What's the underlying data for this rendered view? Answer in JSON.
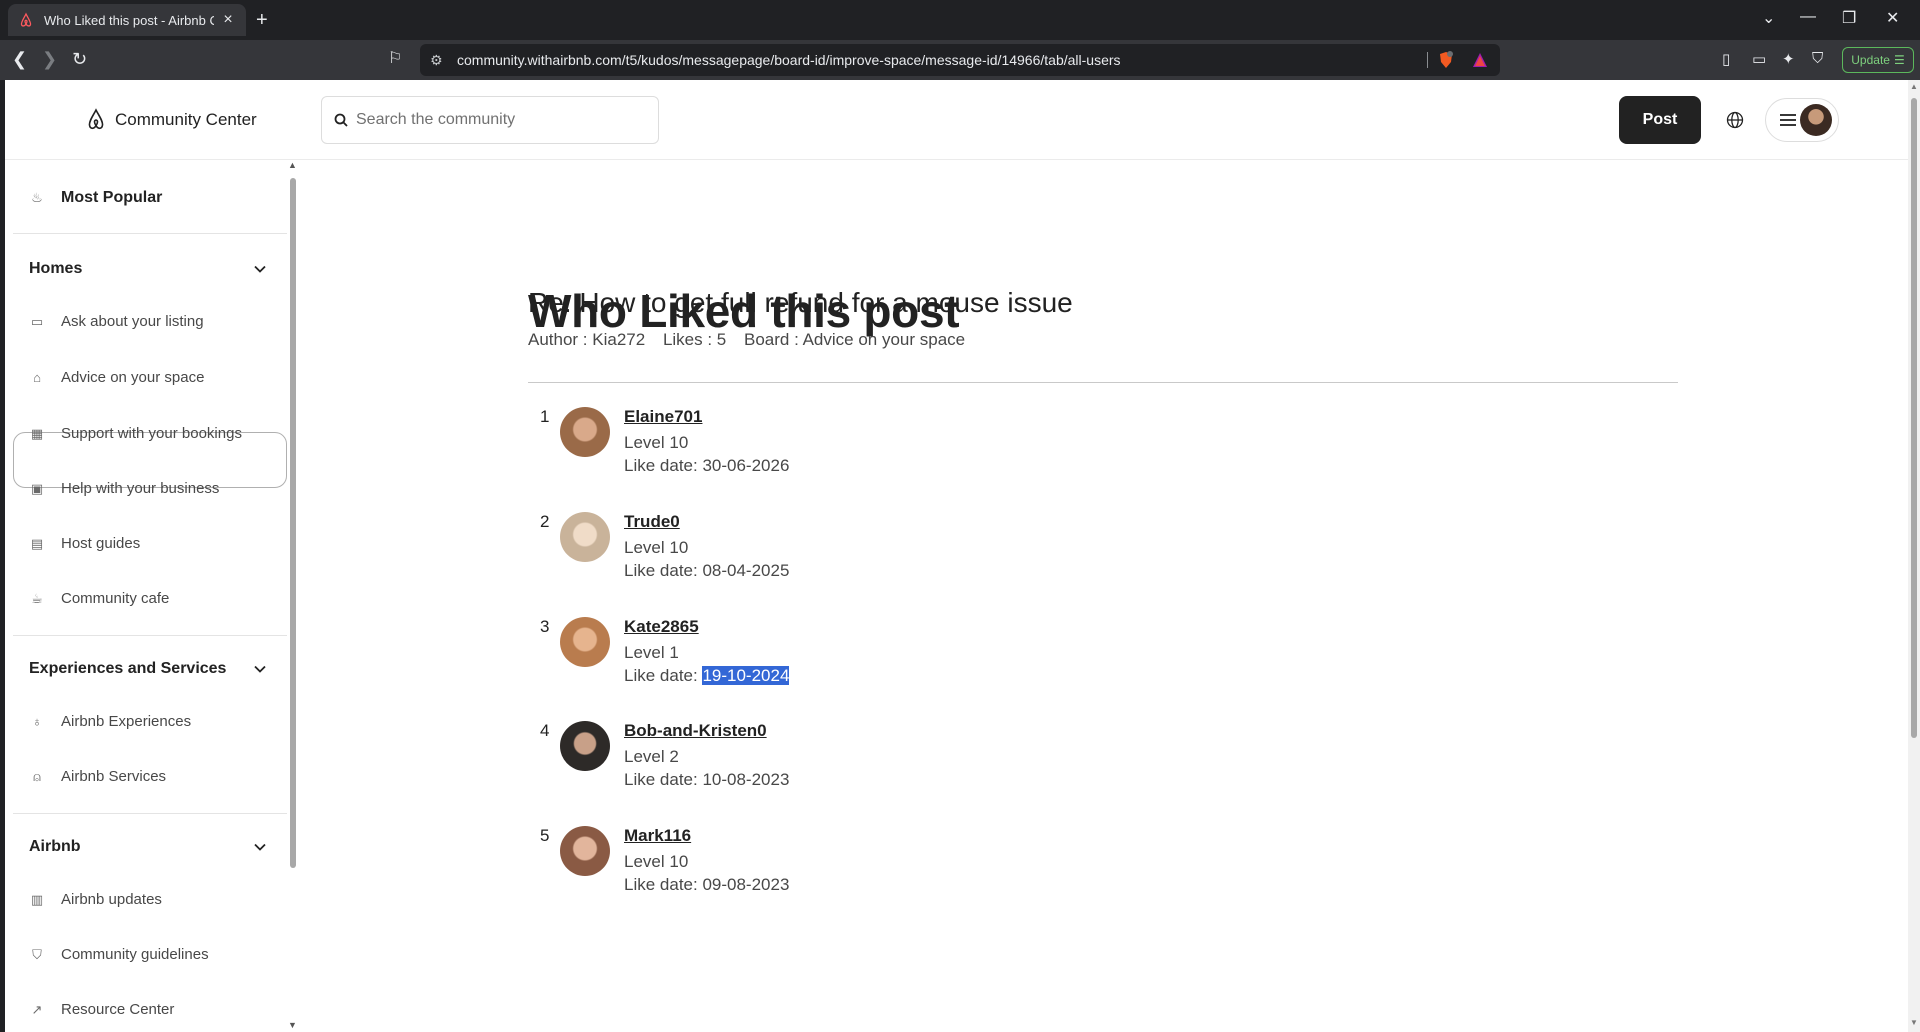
{
  "browser": {
    "tab_title": "Who Liked this post - Airbnb Co",
    "url": "community.withairbnb.com/t5/kudos/messagepage/board-id/improve-space/message-id/14966/tab/all-users",
    "update_label": "Update"
  },
  "header": {
    "logo_text": "Community Center",
    "search_placeholder": "Search the community",
    "post_label": "Post"
  },
  "sidebar": {
    "most_popular": "Most Popular",
    "sections": [
      {
        "title": "Homes",
        "items": [
          "Ask about your listing",
          "Advice on your space",
          "Support with your bookings",
          "Help with your business",
          "Host guides",
          "Community cafe"
        ]
      },
      {
        "title": "Experiences and Services",
        "items": [
          "Airbnb Experiences",
          "Airbnb Services"
        ]
      },
      {
        "title": "Airbnb",
        "items": [
          "Airbnb updates",
          "Community guidelines",
          "Resource Center"
        ]
      }
    ],
    "active_item": "Advice on your space"
  },
  "main": {
    "page_title": "Who Liked this post",
    "post_title": "Re: How to get full refund for a mouse issue",
    "meta": {
      "author": "Author : Kia272",
      "likes": "Likes : 5",
      "board": "Board : Advice on your space"
    },
    "likers": [
      {
        "num": "1",
        "username": "Elaine701",
        "level": "Level 10",
        "date_prefix": "Like date: ",
        "date": "30-06-2026"
      },
      {
        "num": "2",
        "username": "Trude0",
        "level": "Level 10",
        "date_prefix": "Like date: ",
        "date": "08-04-2025"
      },
      {
        "num": "3",
        "username": "Kate2865",
        "level": "Level 1",
        "date_prefix": "Like date: ",
        "date": "19-10-2024"
      },
      {
        "num": "4",
        "username": "Bob-and-Kristen0",
        "level": "Level 2",
        "date_prefix": "Like date: ",
        "date": "10-08-2023"
      },
      {
        "num": "5",
        "username": "Mark116",
        "level": "Level 10",
        "date_prefix": "Like date: ",
        "date": "09-08-2023"
      }
    ],
    "selected_text": "19-10-2024"
  },
  "colors": {
    "brand": "#ff385c",
    "text": "#222222",
    "selection": "#3367d6"
  }
}
